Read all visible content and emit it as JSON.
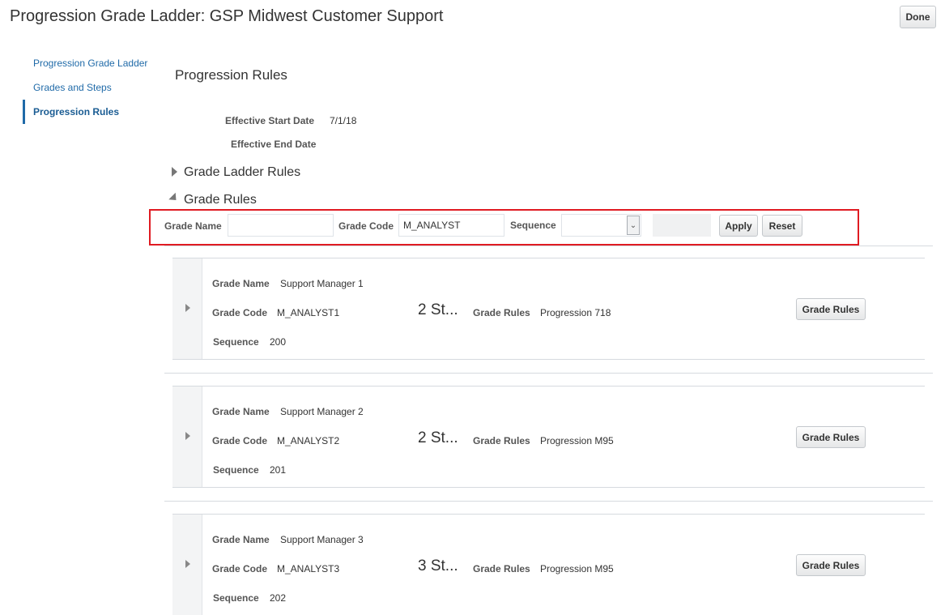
{
  "header": {
    "title": "Progression Grade Ladder: GSP Midwest Customer Support",
    "done_label": "Done"
  },
  "nav": {
    "items": [
      {
        "label": "Progression Grade Ladder",
        "active": false
      },
      {
        "label": "Grades and Steps",
        "active": false
      },
      {
        "label": "Progression Rules",
        "active": true
      }
    ]
  },
  "main": {
    "section_title": "Progression Rules",
    "effective_start_label": "Effective Start Date",
    "effective_start_value": "7/1/18",
    "effective_end_label": "Effective End Date",
    "grade_ladder_rules_label": "Grade Ladder Rules",
    "grade_rules_label": "Grade Rules"
  },
  "search": {
    "grade_name_label": "Grade Name",
    "grade_name_value": "",
    "grade_code_label": "Grade Code",
    "grade_code_value": "M_ANALYST",
    "sequence_label": "Sequence",
    "sequence_value": "",
    "apply_label": "Apply",
    "reset_label": "Reset"
  },
  "grades": [
    {
      "name_label": "Grade Name",
      "name": "Support Manager 1",
      "code_label": "Grade Code",
      "code": "M_ANALYST1",
      "steps": "2 St...",
      "rules_label": "Grade Rules",
      "rules": "Progression 718",
      "seq_label": "Sequence",
      "seq": "200",
      "button_label": "Grade Rules"
    },
    {
      "name_label": "Grade Name",
      "name": "Support Manager 2",
      "code_label": "Grade Code",
      "code": "M_ANALYST2",
      "steps": "2 St...",
      "rules_label": "Grade Rules",
      "rules": "Progression M95",
      "seq_label": "Sequence",
      "seq": "201",
      "button_label": "Grade Rules"
    },
    {
      "name_label": "Grade Name",
      "name": "Support Manager 3",
      "code_label": "Grade Code",
      "code": "M_ANALYST3",
      "steps": "3 St...",
      "rules_label": "Grade Rules",
      "rules": "Progression M95",
      "seq_label": "Sequence",
      "seq": "202",
      "button_label": "Grade Rules"
    }
  ],
  "icons": {
    "expand": "triangle-right-icon",
    "collapse": "triangle-down-icon",
    "dropdown": "chevron-down-icon"
  },
  "colors": {
    "accent": "#1f6aa8",
    "highlight_border": "#e01b22"
  }
}
